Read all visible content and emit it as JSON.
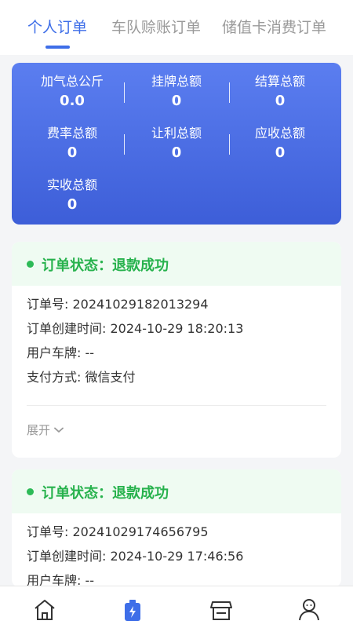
{
  "tabs": [
    {
      "label": "个人订单",
      "active": true
    },
    {
      "label": "车队赊账订单",
      "active": false
    },
    {
      "label": "储值卡消费订单",
      "active": false
    }
  ],
  "summary": {
    "gas_kg": {
      "label": "加气总公斤",
      "value": "0.0"
    },
    "list_price": {
      "label": "挂牌总额",
      "value": "0"
    },
    "settlement": {
      "label": "结算总额",
      "value": "0"
    },
    "fee_rate": {
      "label": "费率总额",
      "value": "0"
    },
    "discount": {
      "label": "让利总额",
      "value": "0"
    },
    "receivable": {
      "label": "应收总额",
      "value": "0"
    },
    "received": {
      "label": "实收总额",
      "value": "0"
    }
  },
  "orders": [
    {
      "status": "订单状态：退款成功",
      "order_no": "订单号: 20241029182013294",
      "created": "订单创建时间: 2024-10-29 18:20:13",
      "plate": "用户车牌: --",
      "payment": "支付方式: 微信支付",
      "expand_label": "展开"
    },
    {
      "status": "订单状态：退款成功",
      "order_no": "订单号: 20241029174656795",
      "created": "订单创建时间: 2024-10-29 17:46:56",
      "plate": "用户车牌: --"
    }
  ],
  "colors": {
    "accent": "#3e6ee8",
    "success": "#27b24d",
    "card_gradient_top": "#5b7ef0",
    "card_gradient_bottom": "#3d5ed8"
  },
  "nav": [
    {
      "icon": "home-icon",
      "active": false
    },
    {
      "icon": "gas-station-icon",
      "active": true
    },
    {
      "icon": "store-icon",
      "active": false
    },
    {
      "icon": "user-icon",
      "active": false
    }
  ]
}
